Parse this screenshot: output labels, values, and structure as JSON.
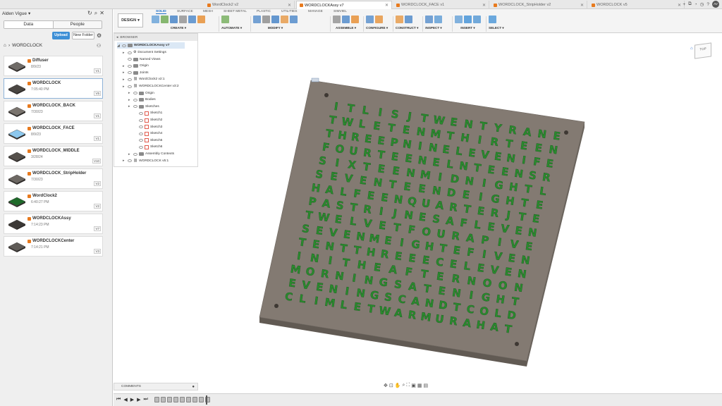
{
  "user": {
    "name": "Alden Vigue"
  },
  "left_tabs": [
    "Data",
    "People"
  ],
  "buttons": {
    "upload": "Upload",
    "new_folder": "New Folder"
  },
  "breadcrumb": "WORDCLOCK",
  "files": [
    {
      "name": "Diffuser",
      "date": "8/9/23",
      "ver": "V1"
    },
    {
      "name": "WORDCLOCK",
      "date": "7:05:40 PM",
      "ver": "V5"
    },
    {
      "name": "WORDCLOCK_BACK",
      "date": "7/30/23",
      "ver": "V1"
    },
    {
      "name": "WORDCLOCK_FACE",
      "date": "8/9/23",
      "ver": "V1"
    },
    {
      "name": "WORDCLOCK_MIDDLE",
      "date": "3/28/24",
      "ver": "V10"
    },
    {
      "name": "WORDCLOCK_StripHolder",
      "date": "7/30/23",
      "ver": "V2"
    },
    {
      "name": "WordClock2",
      "date": "6:40:27 PM",
      "ver": "V2"
    },
    {
      "name": "WORDCLOCKAssy",
      "date": "7:14:23 PM",
      "ver": "V7"
    },
    {
      "name": "WORDCLOCKCenter",
      "date": "7:14:21 PM",
      "ver": "V3"
    }
  ],
  "doc_tabs": [
    "WordClock2 v2",
    "WORDCLOCKAssy v7",
    "WORDCLOCK_FACE v1",
    "WORDCLOCK_StripHolder v2",
    "WORDCLOCK v5"
  ],
  "workspace": "DESIGN",
  "toolbar_tabs": [
    "SOLID",
    "SURFACE",
    "MESH",
    "SHEET METAL",
    "PLASTIC",
    "UTILITIES",
    "MANAGE",
    "SIMVIEL"
  ],
  "groups": [
    "CREATE",
    "AUTOMATE",
    "MODIFY",
    "ASSEMBLE",
    "CONFIGURE",
    "CONSTRUCT",
    "INSPECT",
    "INSERT",
    "SELECT"
  ],
  "browser": {
    "title": "BROWSER",
    "root": "WORDCLOCKAssy v7",
    "items": [
      "Document Settings",
      "Named Views",
      "Origin",
      "Joints",
      "WordClock2 v2:1",
      "WORDCLOCKCenter v3:2",
      "Origin",
      "Bodies",
      "Sketches",
      "Sketch1",
      "Sketch2",
      "Sketch3",
      "Sketch4",
      "Sketch5",
      "Sketch6",
      "Assembly Contexts",
      "WORDCLOCK v5:1"
    ]
  },
  "comments": "COMMENTS",
  "viewcube": "TOP",
  "clock_rows": [
    "ITLISJTWENTYRANE",
    "TWLETENMTHIRTEEN",
    "THREEPNINELEVENIFE",
    "FOURTEENELNTEENSR",
    "SIXTEENMIDNIGHTL",
    "SEVENTEENDEIGHTE",
    "HALFEENQUARTERJTE",
    "PASTRIJNESAFLEVEN",
    "TWELVETFOURAPIVE",
    "SEVENMEIGHTEFIVEN",
    "TENTTHREEECELEVEN",
    "INITHEAFTERNOON",
    "MORNINGSATENIGHT",
    "EVENINGSCANDTCOLD",
    "CLIMLETWARMURAHAT"
  ],
  "colors": {
    "accent": "#1d6fc8",
    "plate": "#7e766f",
    "letters": "#2a8a2e"
  }
}
